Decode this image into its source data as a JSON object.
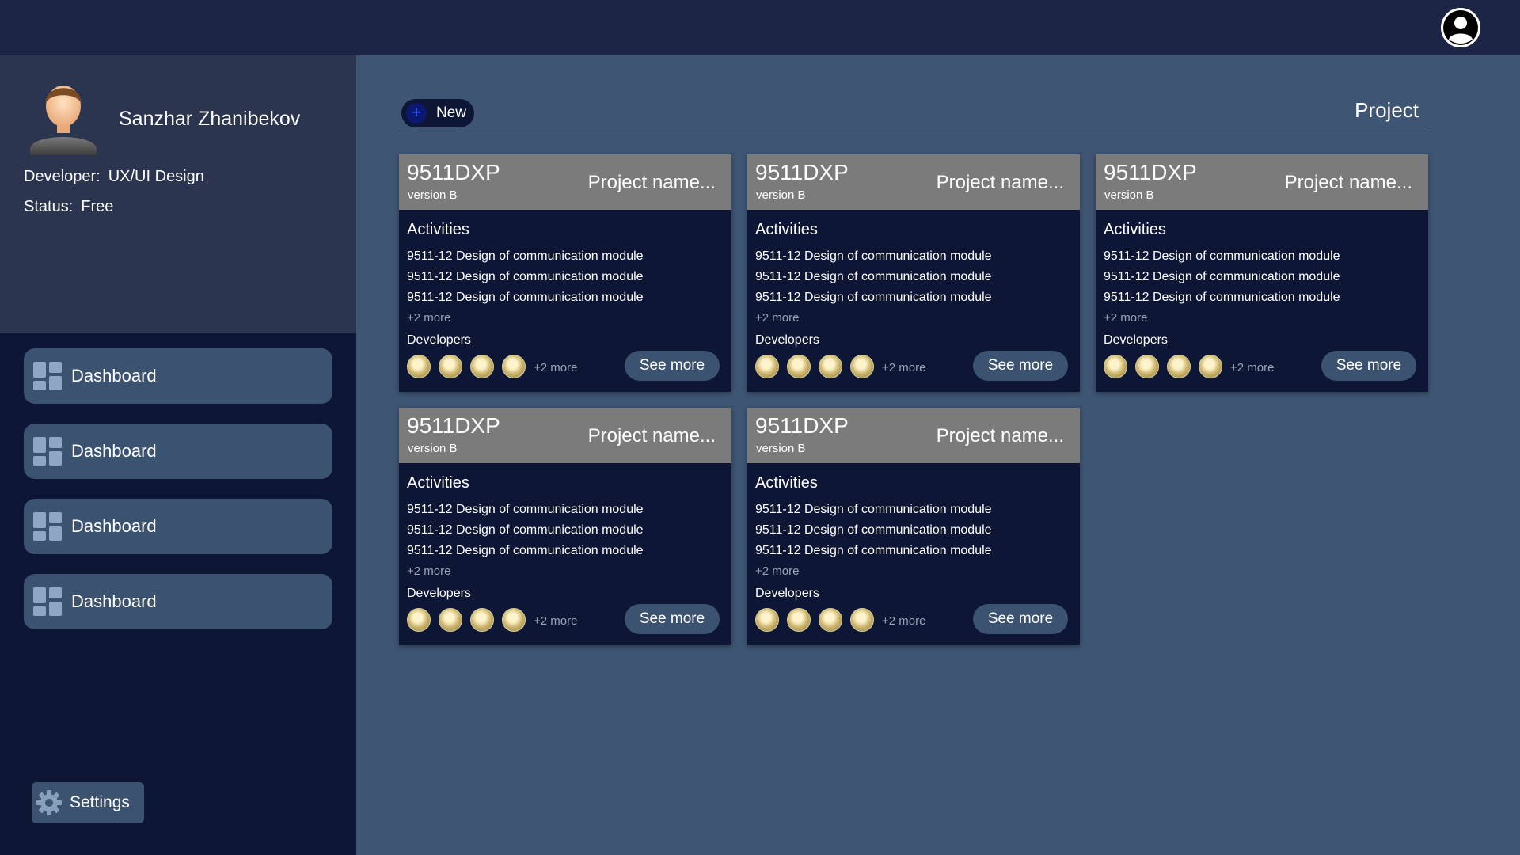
{
  "header": {
    "avatar_icon": "user-circle-icon"
  },
  "profile": {
    "name": "Sanzhar Zhanibekov",
    "developer_label": "Developer:",
    "developer_value": "UX/UI Design",
    "status_label": "Status:",
    "status_value": "Free"
  },
  "sidebar": {
    "items": [
      {
        "label": "Dashboard",
        "icon": "dashboard-icon"
      },
      {
        "label": "Dashboard",
        "icon": "dashboard-icon"
      },
      {
        "label": "Dashboard",
        "icon": "dashboard-icon"
      },
      {
        "label": "Dashboard",
        "icon": "dashboard-icon"
      }
    ],
    "settings_label": "Settings"
  },
  "toolbar": {
    "new_label": "New",
    "new_icon": "plus-circle-icon",
    "title": "Project"
  },
  "cards": [
    {
      "code": "9511DXP",
      "version": "version B",
      "name": "Project name...",
      "activities_title": "Activities",
      "activities": [
        "9511-12 Design of communication module",
        "9511-12 Design of communication module",
        "9511-12 Design of communication module"
      ],
      "activities_more": "+2 more",
      "developers_title": "Developers",
      "developers_more": "+2 more",
      "see_more_label": "See more"
    },
    {
      "code": "9511DXP",
      "version": "version B",
      "name": "Project name...",
      "activities_title": "Activities",
      "activities": [
        "9511-12 Design of communication module",
        "9511-12 Design of communication module",
        "9511-12 Design of communication module"
      ],
      "activities_more": "+2 more",
      "developers_title": "Developers",
      "developers_more": "+2 more",
      "see_more_label": "See more"
    },
    {
      "code": "9511DXP",
      "version": "version B",
      "name": "Project name...",
      "activities_title": "Activities",
      "activities": [
        "9511-12 Design of communication module",
        "9511-12 Design of communication module",
        "9511-12 Design of communication module"
      ],
      "activities_more": "+2 more",
      "developers_title": "Developers",
      "developers_more": "+2 more",
      "see_more_label": "See more"
    },
    {
      "code": "9511DXP",
      "version": "version B",
      "name": "Project name...",
      "activities_title": "Activities",
      "activities": [
        "9511-12 Design of communication module",
        "9511-12 Design of communication module",
        "9511-12 Design of communication module"
      ],
      "activities_more": "+2 more",
      "developers_title": "Developers",
      "developers_more": "+2 more",
      "see_more_label": "See more"
    },
    {
      "code": "9511DXP",
      "version": "version B",
      "name": "Project name...",
      "activities_title": "Activities",
      "activities": [
        "9511-12 Design of communication module",
        "9511-12 Design of communication module",
        "9511-12 Design of communication module"
      ],
      "activities_more": "+2 more",
      "developers_title": "Developers",
      "developers_more": "+2 more",
      "see_more_label": "See more"
    }
  ]
}
